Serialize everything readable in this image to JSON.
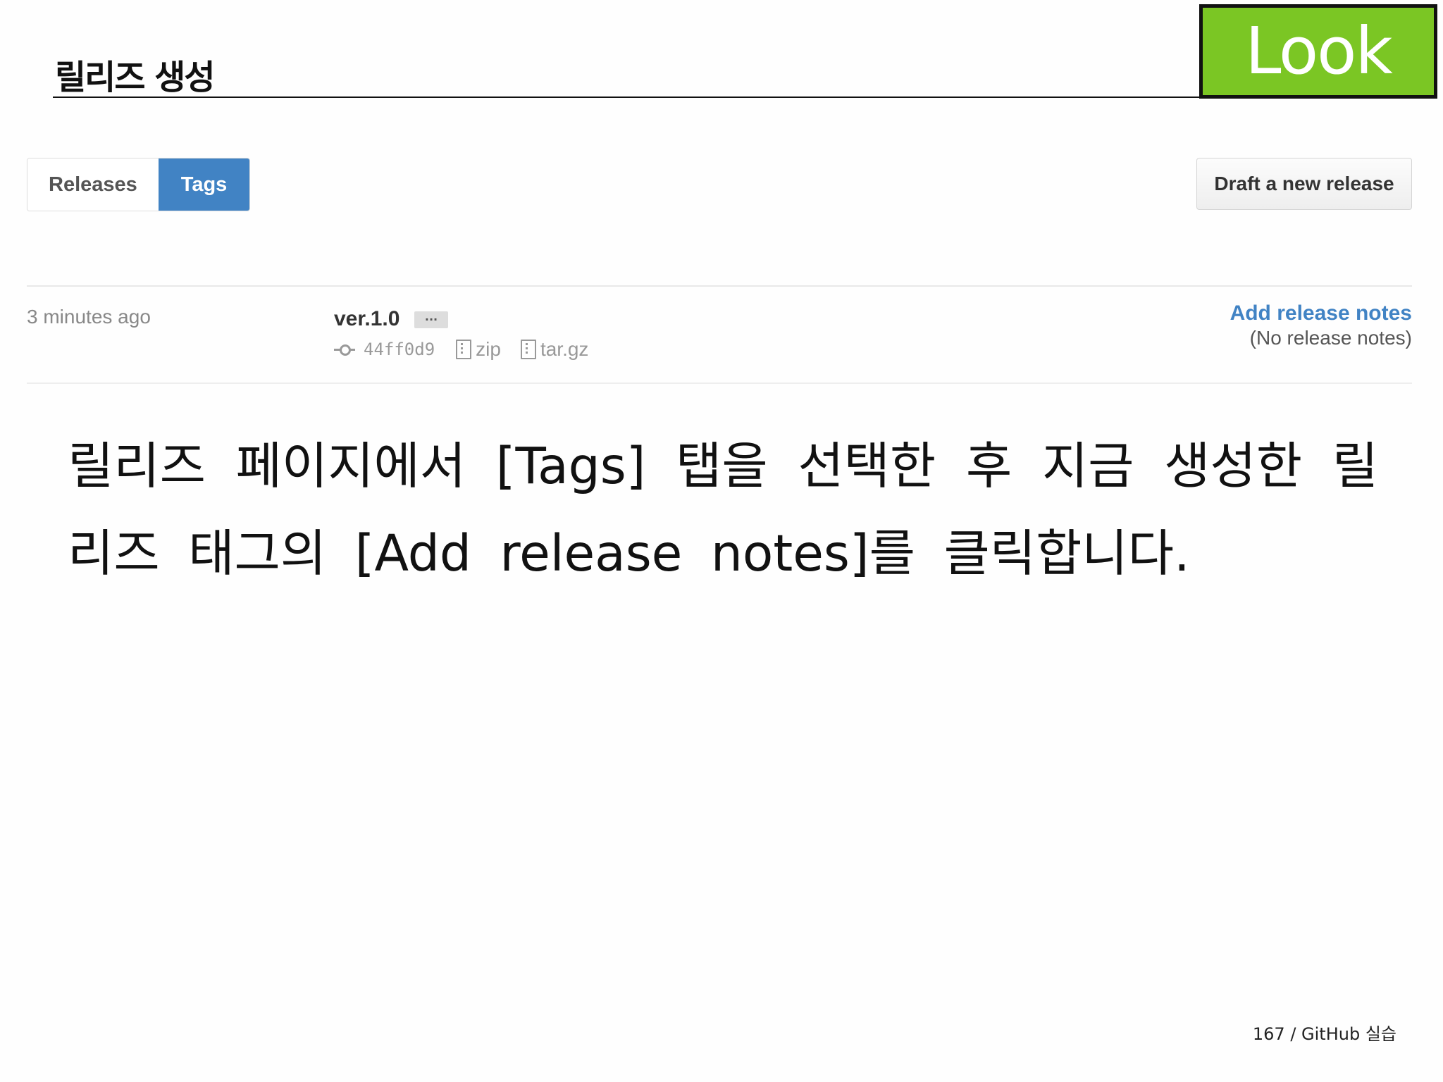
{
  "slide": {
    "title": "릴리즈 생성",
    "badge": "Look",
    "instruction": "릴리즈 페이지에서 [Tags] 탭을 선택한 후 지금 생성한 릴리즈 태그의 [Add release notes]를 클릭합니다.",
    "footer": "167 / GitHub 실습"
  },
  "subnav": {
    "tabs": [
      {
        "label": "Releases",
        "selected": false
      },
      {
        "label": "Tags",
        "selected": true
      }
    ]
  },
  "toolbar": {
    "draft_label": "Draft a new release"
  },
  "tag_row": {
    "time": "3 minutes ago",
    "name": "ver.1.0",
    "ellipsis": "···",
    "commit": "44ff0d9",
    "downloads": [
      "zip",
      "tar.gz"
    ],
    "add_notes_label": "Add release notes",
    "no_notes_label": "(No release notes)"
  },
  "colors": {
    "badge_bg": "#7bc624",
    "selected_tab": "#4183c4",
    "link": "#4183c4"
  },
  "icons": [
    "commit-icon",
    "file-zip-icon",
    "file-tar-icon"
  ]
}
